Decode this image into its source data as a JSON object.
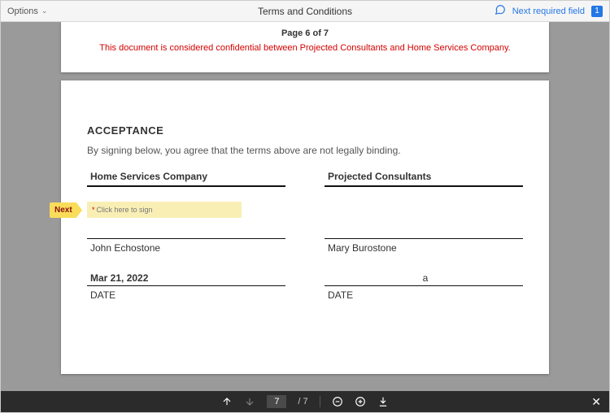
{
  "header": {
    "options_label": "Options",
    "title": "Terms and Conditions",
    "next_field_label": "Next required field",
    "next_field_count": "1"
  },
  "prev_page": {
    "page_label": "Page 6 of 7",
    "confidential": "This document is considered confidential between Projected Consultants and Home Services Company."
  },
  "page": {
    "heading": "ACCEPTANCE",
    "sub": "By signing below, you agree that the terms above are not legally binding.",
    "left": {
      "title": "Home Services Company",
      "sign_placeholder": "Click here to sign",
      "signer": "John Echostone",
      "date_value": "Mar 21, 2022",
      "date_label": "DATE"
    },
    "right": {
      "title": "Projected Consultants",
      "signer": "Mary Burostone",
      "date_value": "a",
      "date_label": "DATE"
    }
  },
  "flag": {
    "label": "Next"
  },
  "footer": {
    "page_input": "7",
    "page_total": "/  7"
  }
}
